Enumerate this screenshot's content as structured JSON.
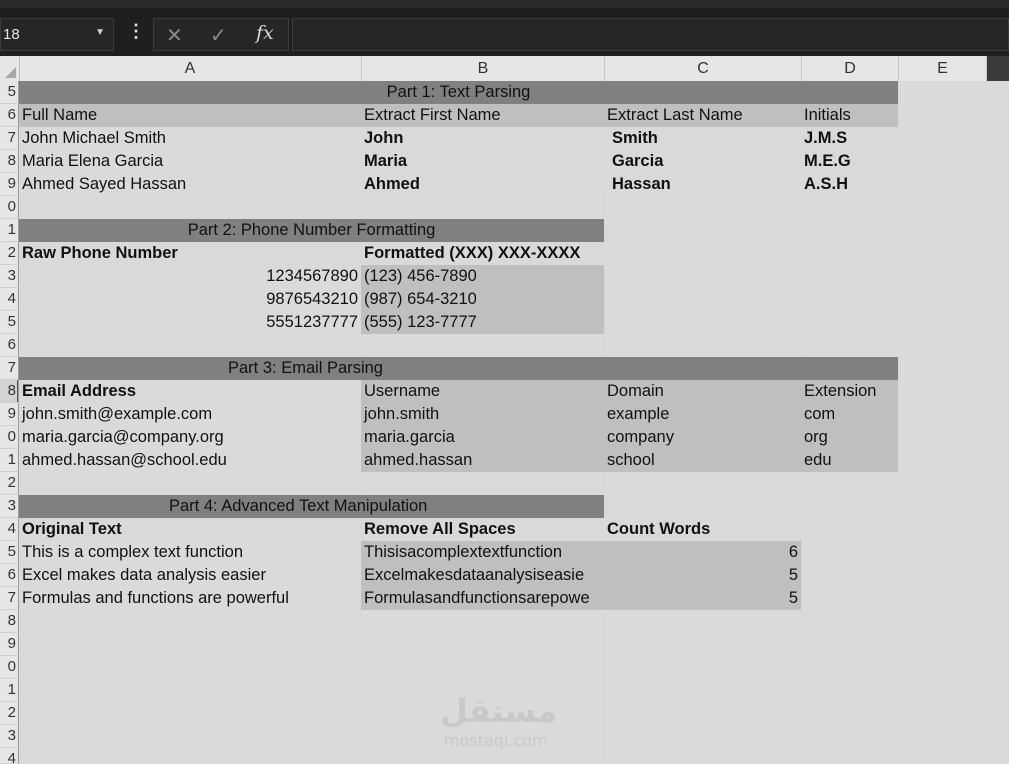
{
  "formula_bar": {
    "name_box": "18",
    "fx_label": "fx",
    "formula": ""
  },
  "columns": [
    "A",
    "B",
    "C",
    "D",
    "E"
  ],
  "rows": [
    "5",
    "6",
    "7",
    "8",
    "9",
    "0",
    "1",
    "2",
    "3",
    "4",
    "5",
    "6",
    "7",
    "8",
    "9",
    "0",
    "1",
    "2",
    "3",
    "4",
    "5",
    "6",
    "7",
    "8",
    "9",
    "0",
    "1",
    "2",
    "3",
    "4"
  ],
  "part1": {
    "title": "Part 1: Text Parsing",
    "headers": [
      "Full Name",
      "Extract First Name",
      "Extract Last Name",
      "Initials"
    ],
    "rows": [
      [
        "John Michael Smith",
        "John",
        "Smith",
        "J.M.S"
      ],
      [
        "Maria Elena Garcia",
        "Maria",
        "Garcia",
        "M.E.G"
      ],
      [
        "Ahmed Sayed Hassan",
        "Ahmed",
        "Hassan",
        "A.S.H"
      ]
    ]
  },
  "part2": {
    "title": "Part 2: Phone Number Formatting",
    "headers": [
      "Raw Phone Number",
      "Formatted (XXX) XXX-XXXX"
    ],
    "rows": [
      [
        "1234567890",
        "(123) 456-7890"
      ],
      [
        "9876543210",
        "(987) 654-3210"
      ],
      [
        "5551237777",
        "(555) 123-7777"
      ]
    ]
  },
  "part3": {
    "title": "Part 3: Email Parsing",
    "headers": [
      "Email Address",
      "Username",
      "Domain",
      "Extension"
    ],
    "rows": [
      [
        "john.smith@example.com",
        "john.smith",
        "example",
        "com"
      ],
      [
        "maria.garcia@company.org",
        "maria.garcia",
        "company",
        "org"
      ],
      [
        "ahmed.hassan@school.edu",
        "ahmed.hassan",
        "school",
        "edu"
      ]
    ]
  },
  "part4": {
    "title": "Part 4: Advanced Text Manipulation",
    "headers": [
      "Original Text",
      "Remove All Spaces",
      "Count Words"
    ],
    "rows": [
      [
        "This is a complex text function",
        "Thisisacomplextextfunction",
        "6"
      ],
      [
        "Excel makes data analysis easier",
        "Excelmakesdataanalysiseasie",
        "5"
      ],
      [
        "Formulas and functions are powerful",
        "Formulasandfunctionsarepowe",
        "5"
      ]
    ]
  },
  "watermark": {
    "arabic": "مستقل",
    "latin": "mostaql.com"
  }
}
